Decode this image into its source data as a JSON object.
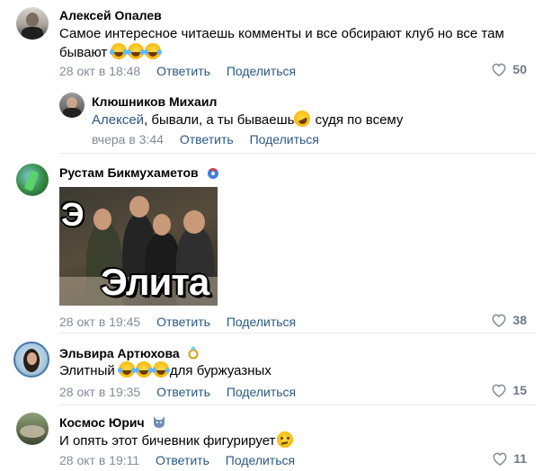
{
  "labels": {
    "reply": "Ответить",
    "share": "Поделиться"
  },
  "comments": [
    {
      "author": "Алексей Опалев",
      "text_line1": "Самое интересное читаешь комменты и все обсирают клуб но все там",
      "text_line2": "бывают",
      "time": "28 окт в 18:48",
      "likes": "50"
    },
    {
      "author": "Клюшников Михаил",
      "mention": "Алексей",
      "text": ", бывали, а ты бываешь",
      "text_after": " судя по всему",
      "time": "вчера в 3:44"
    },
    {
      "author": "Рустам Бикмухаметов",
      "image_caption_top": "Э",
      "image_caption_bottom": "Элита",
      "time": "28 окт в 19:45",
      "likes": "38"
    },
    {
      "author": "Эльвира Артюхова",
      "text_before": "Элитный ",
      "text_after": "для буржуазных",
      "time": "28 окт в 19:35",
      "likes": "15"
    },
    {
      "author": "Космос Юрич",
      "text": "И опять этот бичевник фигурирует",
      "time": "28 окт в 19:11",
      "likes": "11"
    }
  ],
  "icons": {
    "like": "heart-outline-icon"
  },
  "colors": {
    "link": "#2a5885",
    "meta": "#818c99",
    "divider": "#e7e8ec"
  }
}
